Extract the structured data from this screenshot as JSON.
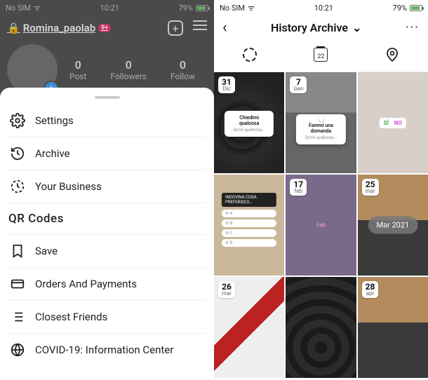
{
  "status": {
    "carrier": "No SIM",
    "time": "10:21",
    "battery_pct": "79%"
  },
  "left": {
    "profile": {
      "username": "Romina_paolab",
      "badge": "9+",
      "stats": {
        "posts_n": "0",
        "posts_l": "Post",
        "followers_n": "0",
        "followers_l": "Followers",
        "following_n": "0",
        "following_l": "Follow"
      }
    },
    "menu": {
      "settings": "Settings",
      "archive": "Archive",
      "business": "Your Business",
      "qrcodes": "QR Codes",
      "save": "Save",
      "orders": "Orders And Payments",
      "closest": "Closest Friends",
      "covid": "COVID-19: Information Center"
    }
  },
  "right": {
    "title": "History Archive",
    "calendar_day": "22",
    "month_overlay": "Mar 2021",
    "cells": [
      {
        "day": "31",
        "month": "Dic",
        "card_t1": "Chiedimi qualcosa",
        "card_t2": "Scrivi qualcosa..."
      },
      {
        "day": "7",
        "month": "Gen",
        "card_t1": "Fammi una domanda",
        "card_t2": "Scrivi qualcosa..."
      },
      {
        "si": "SÍ",
        "no": "NO"
      },
      {
        "poll_h": "INDOVINA COSA PREFERISCO…",
        "a": "⊘ A",
        "b": "⊘ B",
        "c": "⊘ C",
        "d": "⊘ D"
      },
      {
        "day": "17",
        "month": "feb",
        "pink": "Feb"
      },
      {
        "day": "25",
        "month": "mar"
      },
      {
        "day": "26",
        "month": "mar"
      },
      {},
      {
        "day": "28",
        "month": "apr"
      }
    ]
  }
}
